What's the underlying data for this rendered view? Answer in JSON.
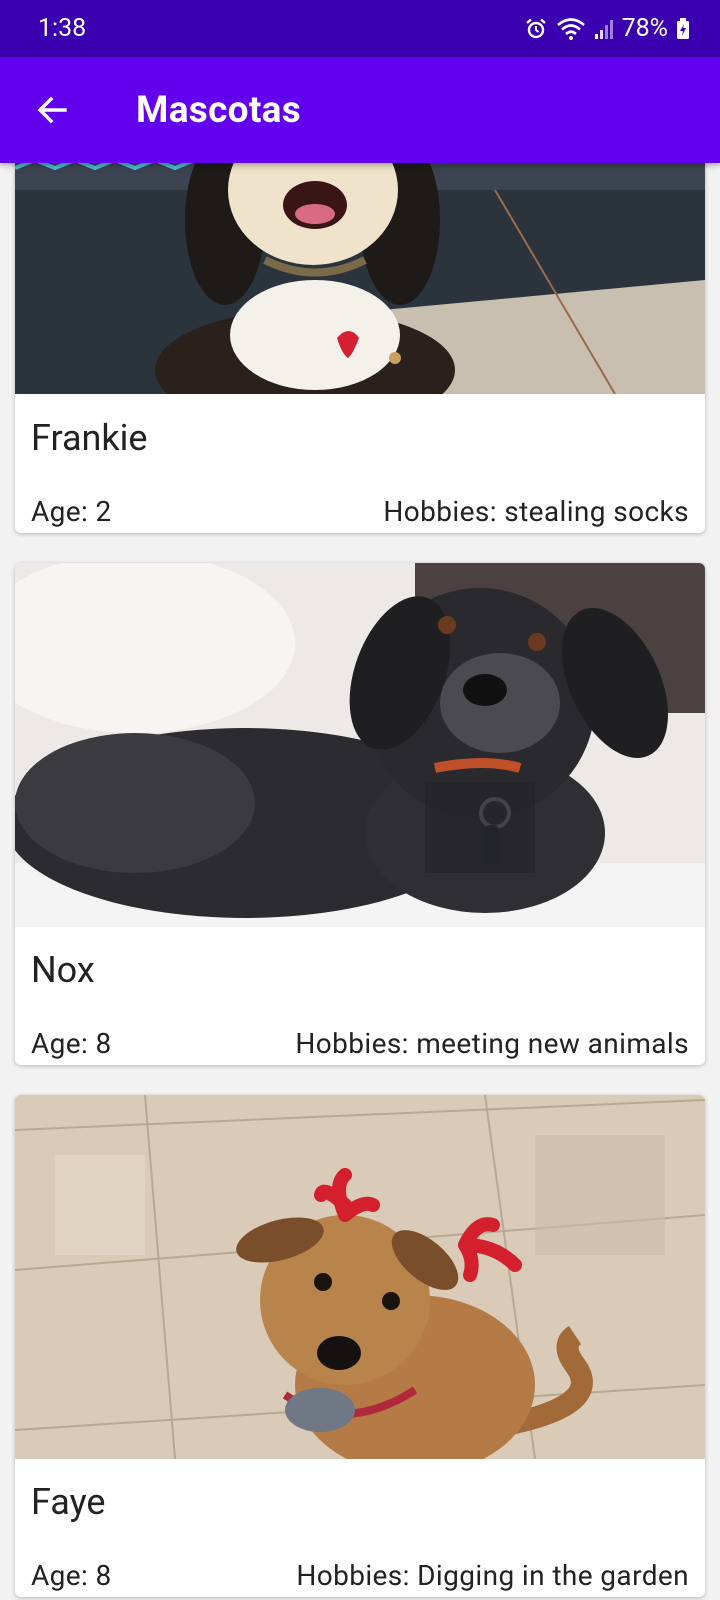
{
  "status_bar": {
    "time": "1:38",
    "battery": "78%",
    "icons": [
      "alarm-icon",
      "wifi-icon",
      "signal-icon",
      "battery-charging-icon"
    ]
  },
  "app_bar": {
    "title": "Mascotas",
    "back_icon": "arrow-back-icon",
    "color": "#6200ee",
    "status_color": "#3a00b0"
  },
  "pets": [
    {
      "name": "Frankie",
      "age": "Age: 2",
      "hobbies": "Hobbies: stealing socks"
    },
    {
      "name": "Nox",
      "age": "Age: 8",
      "hobbies": "Hobbies: meeting new animals"
    },
    {
      "name": "Faye",
      "age": "Age: 8",
      "hobbies": "Hobbies: Digging in the garden"
    }
  ]
}
